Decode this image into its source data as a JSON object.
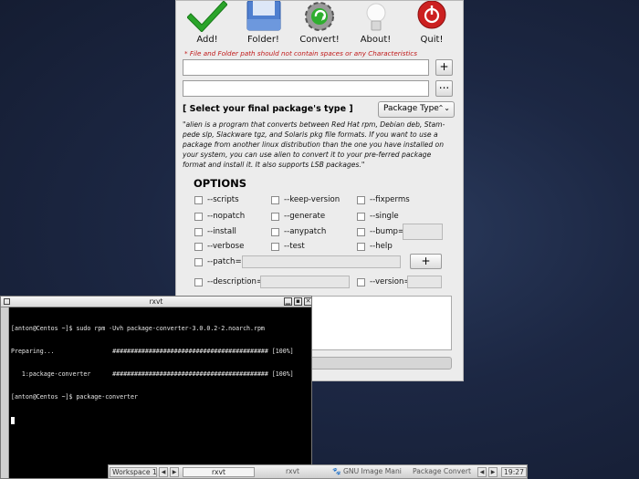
{
  "toolbar": {
    "add_label": "Add!",
    "folder_label": "Folder!",
    "convert_label": "Convert!",
    "about_label": "About!",
    "quit_label": "Quit!"
  },
  "warning": "* File and Folder path should not contain spaces or any Characteristics",
  "path_fields": {
    "path1_value": "",
    "path2_value": "",
    "add_button_label": "+",
    "browse_button_label": "..."
  },
  "package_type": {
    "heading": "[ Select your final package's type ]",
    "select_value": "Package Type"
  },
  "description": "\"alien is a program that converts between Red Hat rpm, Debian deb, Stam-pede slp, Slackware tgz, and Solaris pkg file formats. If you want to use a package from another linux distribution than the one you have installed on your system, you can use alien to convert it to your pre-ferred package format and install it. It also supports LSB packages.\"",
  "options": {
    "title": "OPTIONS",
    "items": [
      "--scripts",
      "--keep-version",
      "--fixperms",
      "--nopatch",
      "--generate",
      "--single",
      "--install",
      "--anypatch",
      "--bump=",
      "--verbose",
      "--test",
      "--help",
      "--patch=",
      "--description=",
      "--version="
    ],
    "patch_add_label": "+"
  },
  "rxvt": {
    "title": "rxvt",
    "lines": [
      "[anton@Centos ~]$ sudo rpm -Uvh package-converter-3.0.0.2-2.noarch.rpm",
      "Preparing...                ########################################### [100%]",
      "   1:package-converter      ########################################### [100%]",
      "[anton@Centos ~]$ package-converter"
    ]
  },
  "taskbar": {
    "workspace": "Workspace 1",
    "tasks": [
      "rxvt",
      "rxvt",
      "GNU Image Mani",
      "Package Convert"
    ],
    "clock": "19:27"
  },
  "colors": {
    "warning": "#c01818",
    "add_icon": "#2aa52a",
    "quit_icon": "#cc2020"
  }
}
